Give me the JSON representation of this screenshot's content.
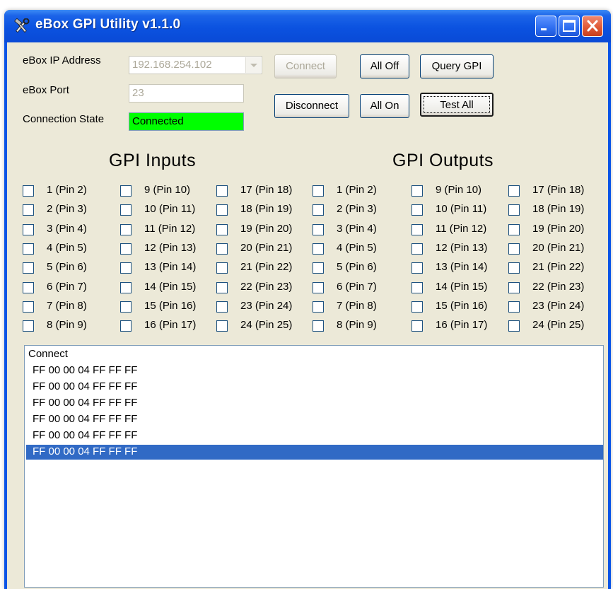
{
  "window": {
    "title": "eBox GPI Utility v1.1.0"
  },
  "connection": {
    "ip_label": "eBox IP Address",
    "ip_value": "192.168.254.102",
    "port_label": "eBox Port",
    "port_value": "23",
    "state_label": "Connection State",
    "state_value": "Connected",
    "state_color": "#00ff00"
  },
  "buttons": {
    "connect": "Connect",
    "disconnect": "Disconnect",
    "all_off": "All Off",
    "all_on": "All On",
    "query_gpi": "Query GPI",
    "test_all": "Test All"
  },
  "inputs": {
    "title": "GPI Inputs",
    "columns": [
      [
        "1 (Pin 2)",
        "2 (Pin 3)",
        "3 (Pin 4)",
        "4 (Pin 5)",
        "5 (Pin 6)",
        "6 (Pin 7)",
        "7 (Pin 8)",
        "8 (Pin 9)"
      ],
      [
        "9 (Pin 10)",
        "10 (Pin 11)",
        "11 (Pin 12)",
        "12 (Pin 13)",
        "13 (Pin 14)",
        "14 (Pin 15)",
        "15 (Pin 16)",
        "16 (Pin 17)"
      ],
      [
        "17 (Pin 18)",
        "18 (Pin 19)",
        "19 (Pin 20)",
        "20 (Pin 21)",
        "21 (Pin 22)",
        "22 (Pin 23)",
        "23 (Pin 24)",
        "24 (Pin 25)"
      ]
    ]
  },
  "outputs": {
    "title": "GPI Outputs",
    "columns": [
      [
        "1 (Pin 2)",
        "2 (Pin 3)",
        "3 (Pin 4)",
        "4 (Pin 5)",
        "5 (Pin 6)",
        "6 (Pin 7)",
        "7 (Pin 8)",
        "8 (Pin 9)"
      ],
      [
        "9 (Pin 10)",
        "10 (Pin 11)",
        "11 (Pin 12)",
        "12 (Pin 13)",
        "13 (Pin 14)",
        "14 (Pin 15)",
        "15 (Pin 16)",
        "16 (Pin 17)"
      ],
      [
        "17 (Pin 18)",
        "18 (Pin 19)",
        "19 (Pin 20)",
        "20 (Pin 21)",
        "21 (Pin 22)",
        "22 (Pin 23)",
        "23 (Pin 24)",
        "24 (Pin 25)"
      ]
    ]
  },
  "log": {
    "lines": [
      "Connect",
      "FF 00 00 04 FF FF FF",
      "FF 00 00 04 FF FF FF",
      "FF 00 00 04 FF FF FF",
      "FF 00 00 04 FF FF FF",
      "FF 00 00 04 FF FF FF",
      "FF 00 00 04 FF FF FF"
    ],
    "selected_index": 6
  },
  "icons": {
    "app": "hammer-wrench-icon",
    "minimize": "minimize-icon",
    "maximize": "maximize-icon",
    "close": "close-icon",
    "combo": "chevron-down-icon"
  }
}
